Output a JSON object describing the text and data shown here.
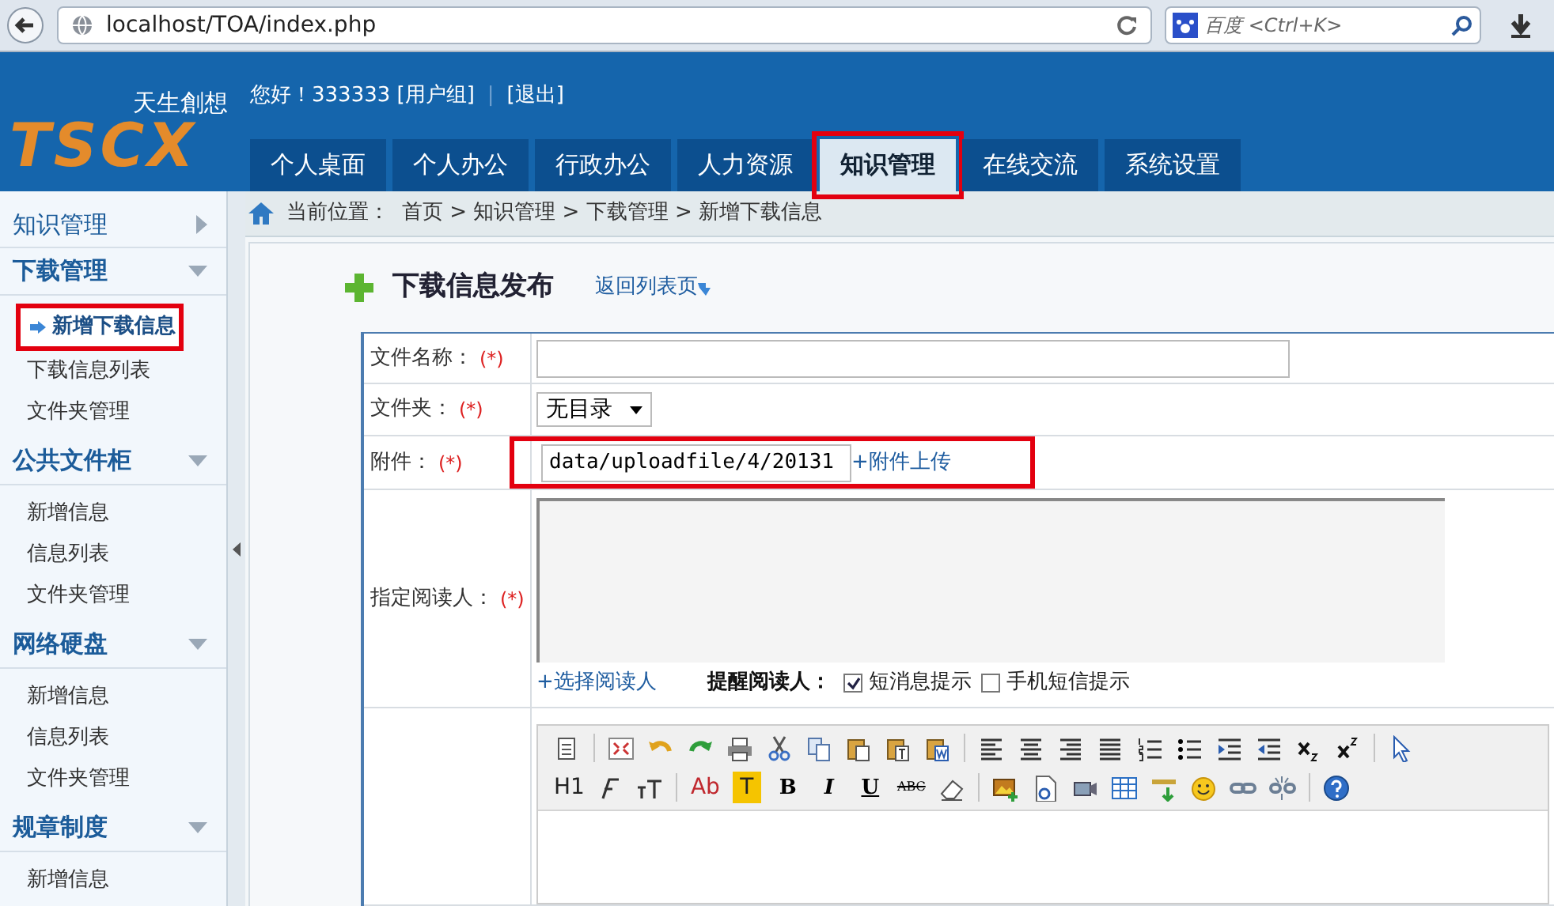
{
  "browser": {
    "url": "localhost/TOA/index.php",
    "search_placeholder": "百度 <Ctrl+K>"
  },
  "header": {
    "greeting": "您好！333333 [用户组]",
    "separator": "|",
    "logout": "[退出]",
    "logo_tagline": "天生創想",
    "logo_letters": "TSCX"
  },
  "tabs": [
    {
      "label": "个人桌面",
      "selected": false,
      "highlighted": false
    },
    {
      "label": "个人办公",
      "selected": false,
      "highlighted": false
    },
    {
      "label": "行政办公",
      "selected": false,
      "highlighted": false
    },
    {
      "label": "人力资源",
      "selected": false,
      "highlighted": false
    },
    {
      "label": "知识管理",
      "selected": true,
      "highlighted": true
    },
    {
      "label": "在线交流",
      "selected": false,
      "highlighted": false
    },
    {
      "label": "系统设置",
      "selected": false,
      "highlighted": false
    }
  ],
  "sidebar": {
    "groups": [
      {
        "title": "知识管理",
        "kind": "module",
        "expanded": false
      },
      {
        "title": "下载管理",
        "kind": "group",
        "expanded": true,
        "children": [
          {
            "label": "新增下载信息",
            "selected": true,
            "highlighted": true
          },
          {
            "label": "下载信息列表",
            "selected": false,
            "highlighted": false
          },
          {
            "label": "文件夹管理",
            "selected": false,
            "highlighted": false
          }
        ]
      },
      {
        "title": "公共文件柜",
        "kind": "group",
        "expanded": true,
        "children": [
          {
            "label": "新增信息",
            "selected": false,
            "highlighted": false
          },
          {
            "label": "信息列表",
            "selected": false,
            "highlighted": false
          },
          {
            "label": "文件夹管理",
            "selected": false,
            "highlighted": false
          }
        ]
      },
      {
        "title": "网络硬盘",
        "kind": "group",
        "expanded": true,
        "children": [
          {
            "label": "新增信息",
            "selected": false,
            "highlighted": false
          },
          {
            "label": "信息列表",
            "selected": false,
            "highlighted": false
          },
          {
            "label": "文件夹管理",
            "selected": false,
            "highlighted": false
          }
        ]
      },
      {
        "title": "规章制度",
        "kind": "group",
        "expanded": true,
        "children": [
          {
            "label": "新增信息",
            "selected": false,
            "highlighted": false
          }
        ]
      }
    ]
  },
  "breadcrumb": {
    "label": "当前位置：",
    "path": "首页 > 知识管理 > 下载管理 > 新增下载信息"
  },
  "page": {
    "title": "下载信息发布",
    "back_link": "返回列表页"
  },
  "form": {
    "rows": [
      {
        "kind": "text",
        "label": "文件名称：",
        "required": "(*)",
        "value": ""
      },
      {
        "kind": "select",
        "label": "文件夹：",
        "required": "(*)",
        "value": "无目录"
      },
      {
        "kind": "attachment",
        "label": "附件：",
        "required": "(*)",
        "value": "data/uploadfile/4/20131",
        "link": "+附件上传",
        "highlighted": true
      },
      {
        "kind": "readers",
        "label": "指定阅读人：",
        "required": "(*)",
        "link": "+选择阅读人",
        "remind_label": "提醒阅读人：",
        "options": [
          {
            "label": "短消息提示",
            "checked": true
          },
          {
            "label": "手机短信提示",
            "checked": false
          }
        ]
      },
      {
        "kind": "editor",
        "toolbar_texts": [
          "H1",
          "Ab",
          "T",
          "B",
          "I",
          "U",
          "ABC"
        ]
      }
    ]
  }
}
